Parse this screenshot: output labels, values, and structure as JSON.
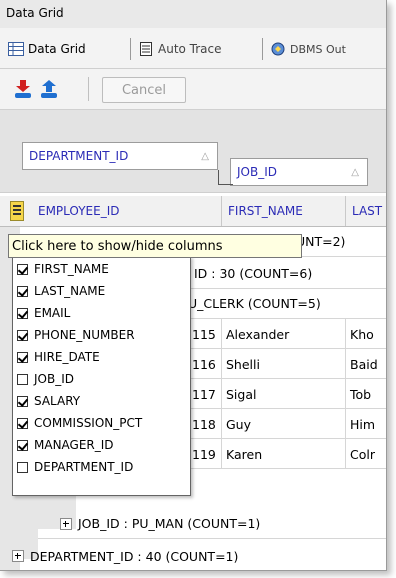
{
  "window": {
    "title": "Data Grid"
  },
  "tabs": [
    {
      "label": "Data Grid",
      "icon": "grid-icon",
      "active": true
    },
    {
      "label": "Auto Trace",
      "icon": "document-icon",
      "active": false
    },
    {
      "label": "DBMS Out",
      "icon": "dbms-output-icon",
      "active": false
    }
  ],
  "toolbar": {
    "buttons": [
      {
        "name": "download-icon",
        "color": "#d02020"
      },
      {
        "name": "upload-icon",
        "color": "#1040c0"
      }
    ],
    "cancel_label": "Cancel"
  },
  "group_panel": {
    "groups": [
      {
        "label": "DEPARTMENT_ID",
        "sort": "△"
      },
      {
        "label": "JOB_ID",
        "sort": "△"
      }
    ]
  },
  "grid": {
    "columns": [
      "EMPLOYEE_ID",
      "FIRST_NAME",
      "LAST"
    ],
    "group_rows": [
      "UNT=2)",
      "ID : 30 (COUNT=6)",
      "U_CLERK (COUNT=5)",
      "JOB_ID : PU_MAN (COUNT=1)",
      "DEPARTMENT_ID : 40 (COUNT=1)"
    ],
    "rows": [
      {
        "id": "115",
        "first": "Alexander",
        "last": "Kho"
      },
      {
        "id": "116",
        "first": "Shelli",
        "last": "Baid"
      },
      {
        "id": "117",
        "first": "Sigal",
        "last": "Tob"
      },
      {
        "id": "118",
        "first": "Guy",
        "last": "Him"
      },
      {
        "id": "119",
        "first": "Karen",
        "last": "Colr"
      }
    ]
  },
  "tooltip": {
    "text": "Click here to show/hide columns"
  },
  "column_chooser": {
    "options": [
      {
        "label": "FIRST_NAME",
        "checked": true
      },
      {
        "label": "LAST_NAME",
        "checked": true
      },
      {
        "label": "EMAIL",
        "checked": true
      },
      {
        "label": "PHONE_NUMBER",
        "checked": true
      },
      {
        "label": "HIRE_DATE",
        "checked": true
      },
      {
        "label": "JOB_ID",
        "checked": false
      },
      {
        "label": "SALARY",
        "checked": true
      },
      {
        "label": "COMMISSION_PCT",
        "checked": true
      },
      {
        "label": "MANAGER_ID",
        "checked": true
      },
      {
        "label": "DEPARTMENT_ID",
        "checked": false
      }
    ]
  }
}
